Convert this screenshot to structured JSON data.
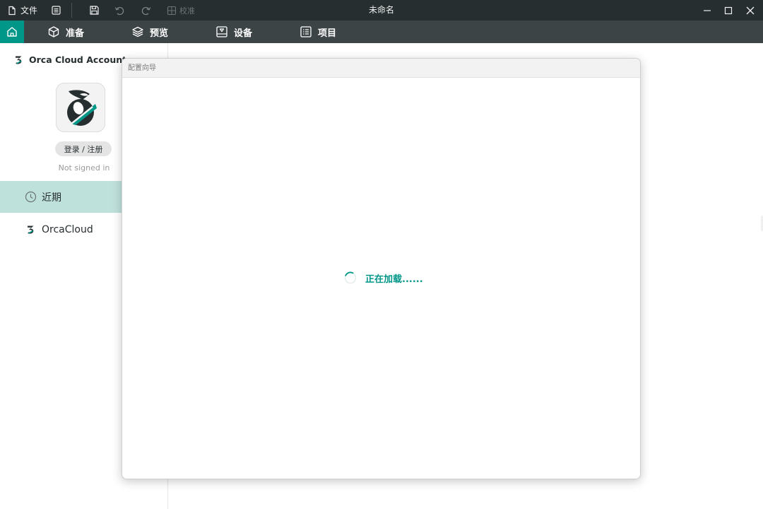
{
  "titlebar": {
    "file_label": "文件",
    "calibrate_label": "校准",
    "window_title": "未命名",
    "icons": [
      "file-icon",
      "menu-icon",
      "save-icon",
      "undo-icon",
      "redo-icon",
      "calibrate-icon",
      "minimize-icon",
      "maximize-icon",
      "close-icon"
    ]
  },
  "tabs": {
    "home_icon": "home-icon",
    "items": [
      {
        "label": "准备",
        "icon": "cube-icon"
      },
      {
        "label": "预览",
        "icon": "layers-icon"
      },
      {
        "label": "设备",
        "icon": "device-icon"
      },
      {
        "label": "项目",
        "icon": "list-icon"
      }
    ]
  },
  "sidebar": {
    "account_title": "Orca Cloud Account",
    "login_label": "登录 / 注册",
    "status": "Not signed in",
    "nav": [
      {
        "label": "近期",
        "icon": "clock-icon",
        "selected": true
      },
      {
        "label": "OrcaCloud",
        "icon": "orca-logo-icon",
        "selected": false
      }
    ]
  },
  "dialog": {
    "title": "配置向导",
    "loading_text": "正在加载......"
  },
  "colors": {
    "accent": "#009688",
    "titlebar_bg": "#262e30",
    "tabbar_bg": "#3d4446",
    "selected_nav_bg": "#bfe1dc"
  }
}
